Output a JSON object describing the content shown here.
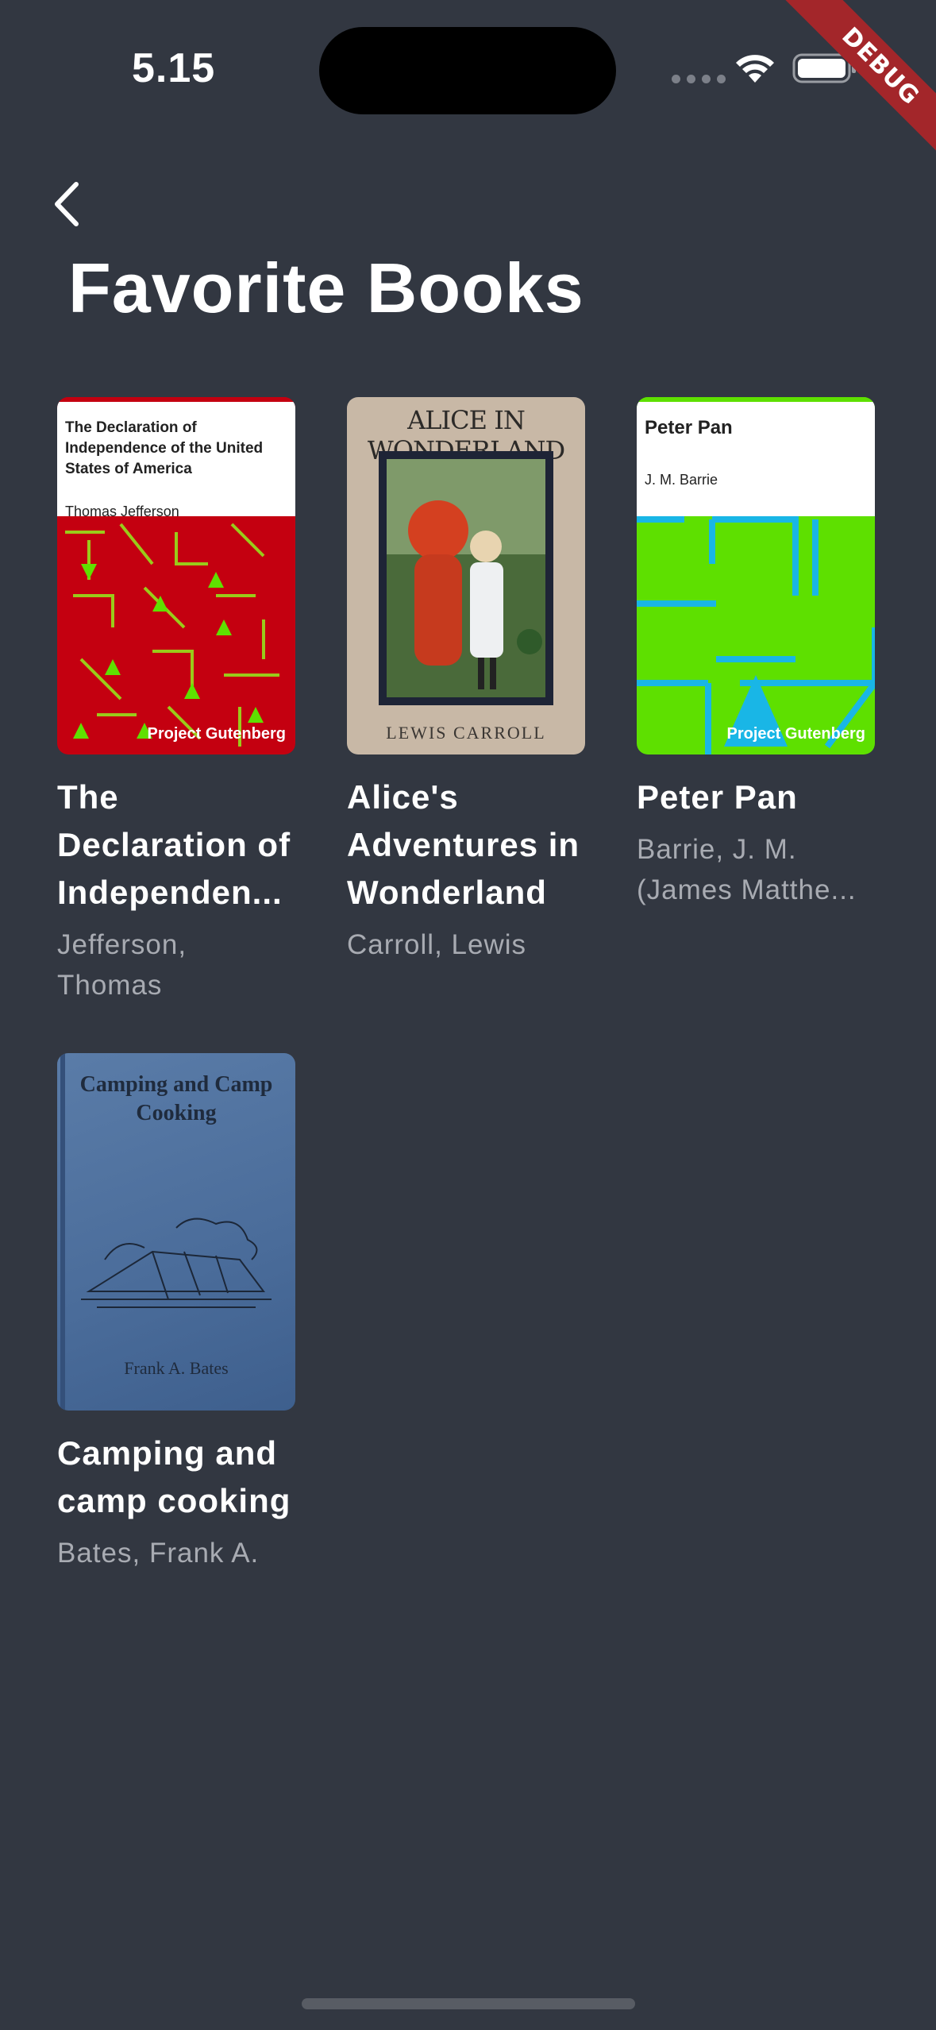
{
  "status_bar": {
    "time": "5.15"
  },
  "debug_banner": "DEBUG",
  "header": {
    "title": "Favorite Books"
  },
  "books": [
    {
      "title": "The Declaration of Independen...",
      "author": "Jefferson, Thomas",
      "cover": {
        "title": "The Declaration of Independence of the United States of America",
        "author": "Thomas Jefferson",
        "brand": "Project Gutenberg",
        "color": "#c40010"
      }
    },
    {
      "title": "Alice's Adventures in Wonderland",
      "author": "Carroll, Lewis",
      "cover": {
        "title": "ALICE IN WONDERLAND",
        "author": "LEWIS CARROLL",
        "color": "#c8b8a6"
      }
    },
    {
      "title": "Peter Pan",
      "author": "Barrie, J. M. (James Matthe...",
      "cover": {
        "title": "Peter Pan",
        "author": "J. M. Barrie",
        "brand": "Project Gutenberg",
        "color": "#5ee000"
      }
    },
    {
      "title": "Camping and camp cooking",
      "author": "Bates, Frank A.",
      "cover": {
        "title": "Camping and Camp Cooking",
        "author": "Frank A. Bates",
        "color": "#4e6f9d"
      }
    }
  ]
}
